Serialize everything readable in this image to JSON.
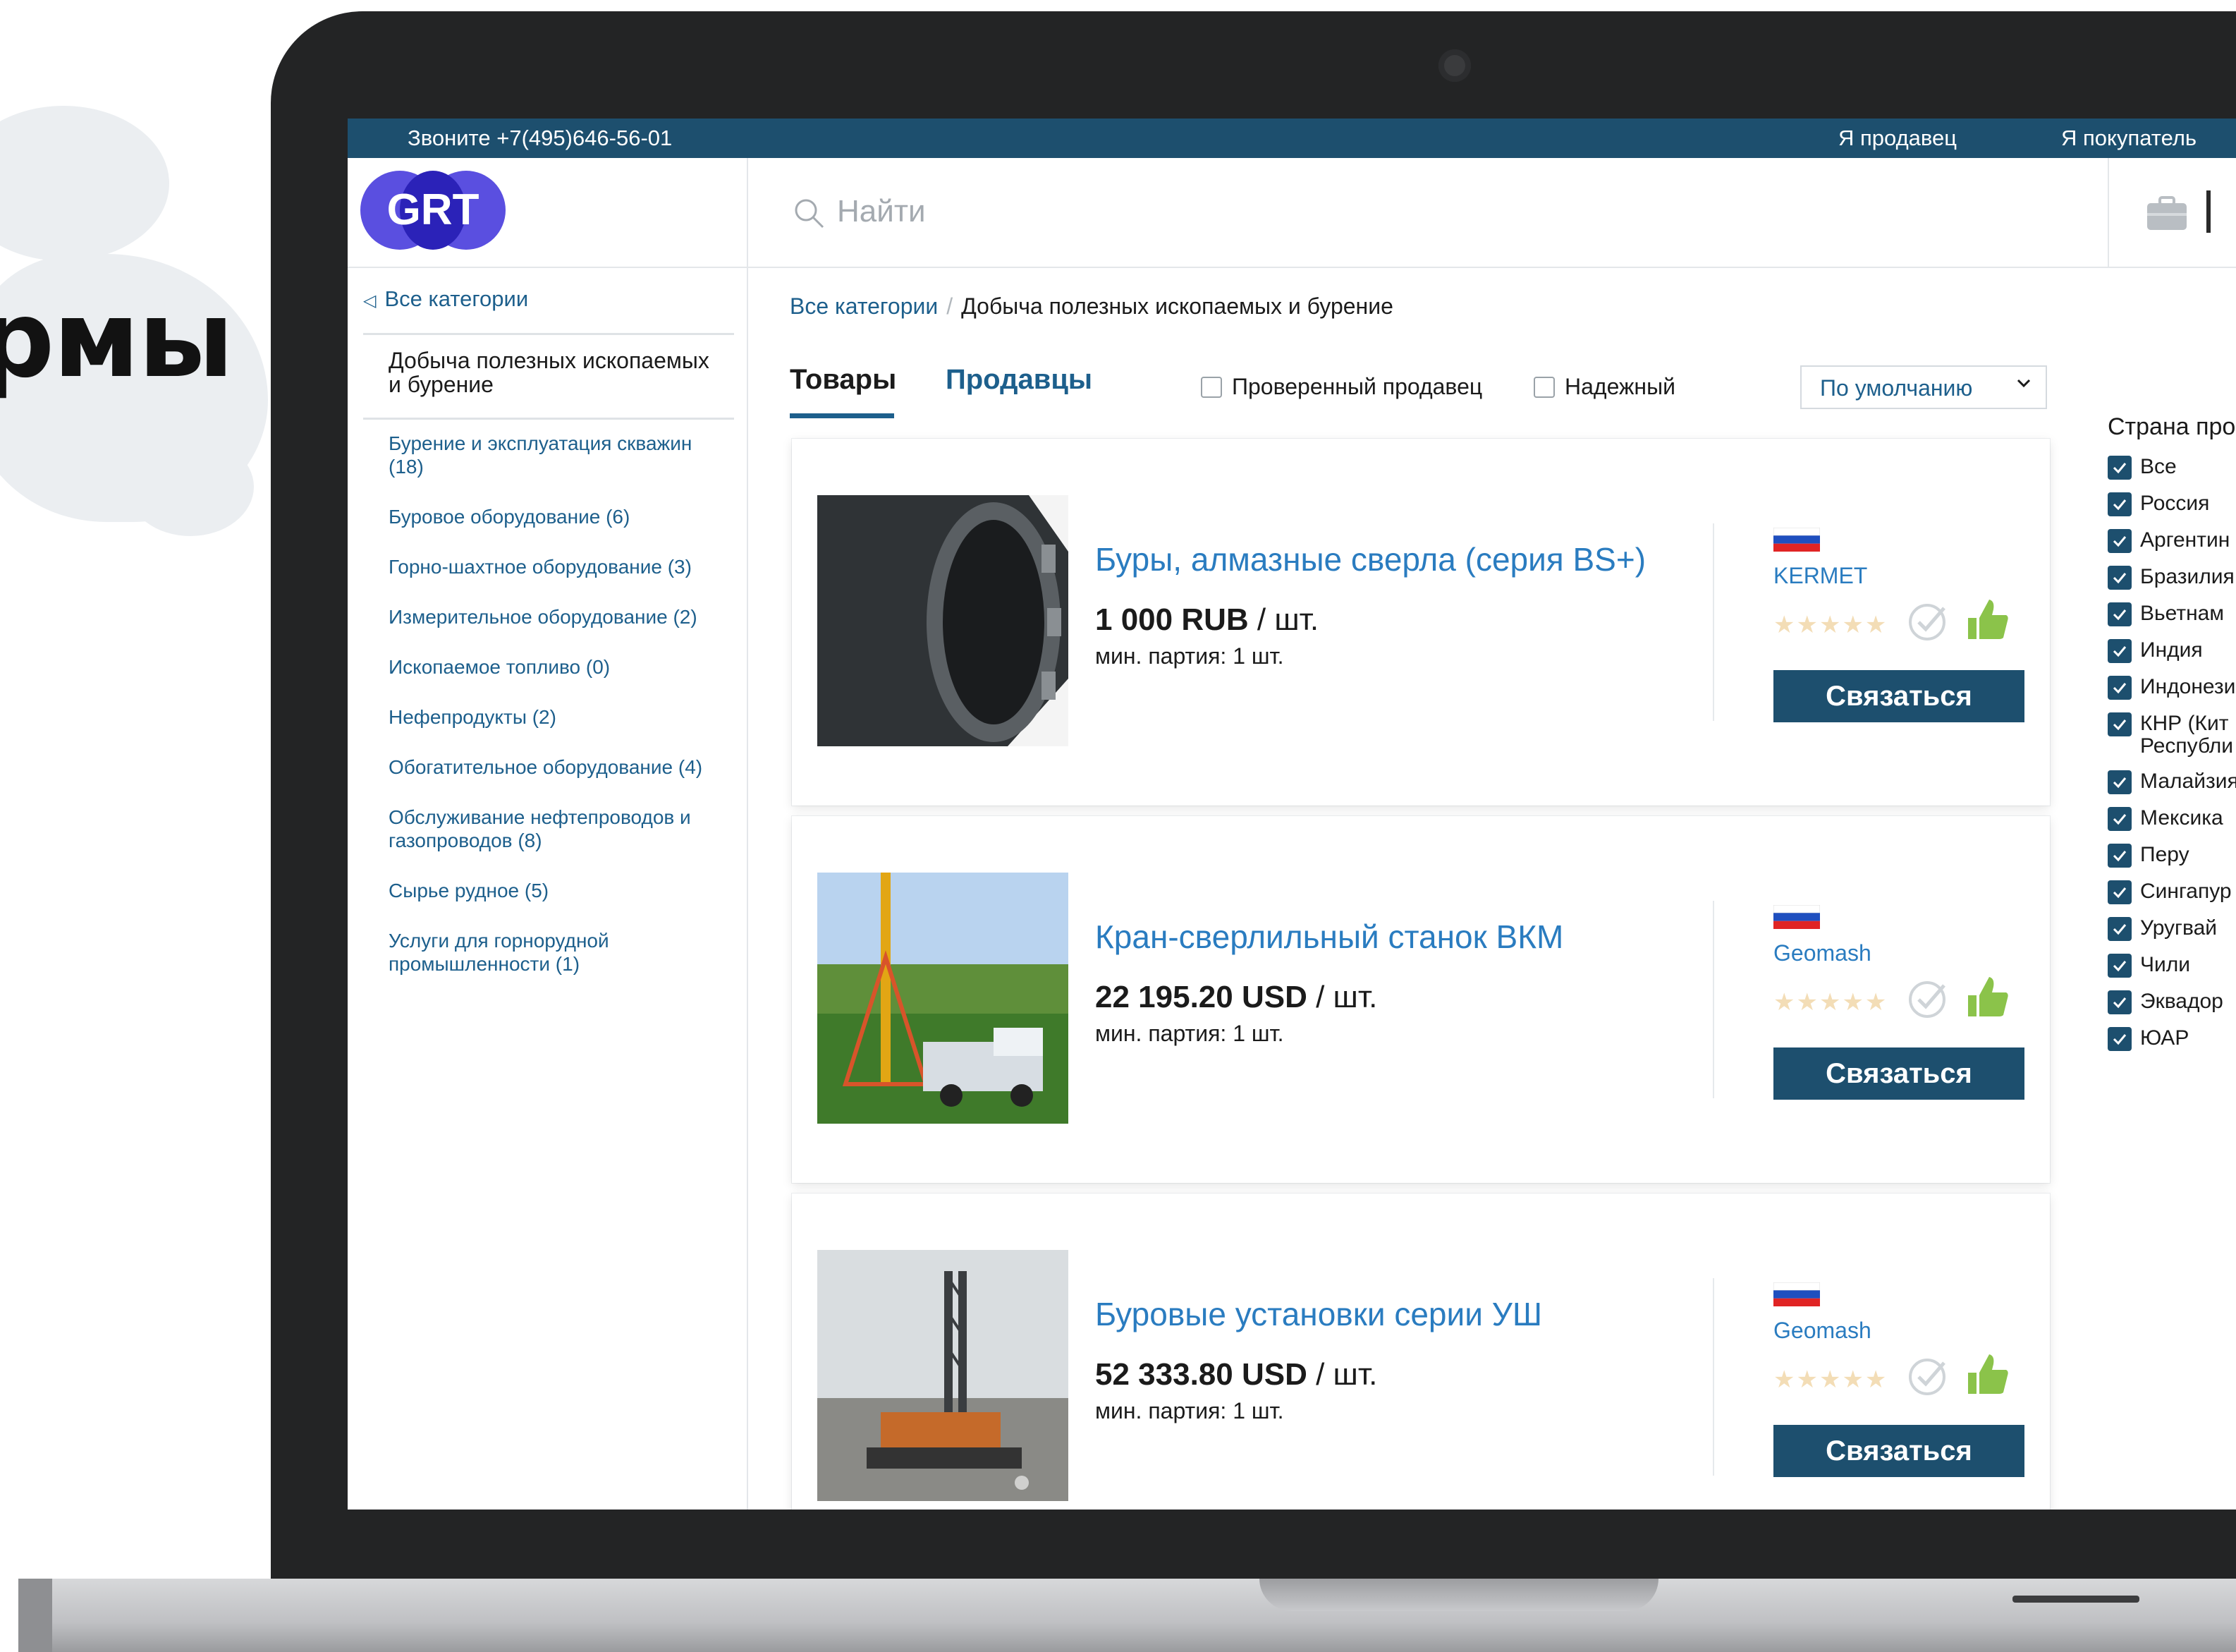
{
  "slide": {
    "title_fragment": "рмы"
  },
  "topbar": {
    "phone": "Звоните +7(495)646-56-01",
    "seller": "Я продавец",
    "buyer": "Я покупатель"
  },
  "header": {
    "logo_text": "GRT",
    "search_placeholder": "Найти"
  },
  "sidebar": {
    "all_categories": "Все категории",
    "current_category": "Добыча полезных ископаемых и бурение",
    "items": [
      {
        "label": "Бурение и эксплуатация скважин (18)"
      },
      {
        "label": "Буровое оборудование (6)"
      },
      {
        "label": "Горно-шахтное оборудование (3)"
      },
      {
        "label": "Измерительное оборудование (2)"
      },
      {
        "label": "Ископаемое топливо (0)"
      },
      {
        "label": "Нефепродукты (2)"
      },
      {
        "label": "Обогатительное оборудование (4)"
      },
      {
        "label": "Обслуживание нефтепроводов и газопроводов (8)"
      },
      {
        "label": "Сырье рудное (5)"
      },
      {
        "label": "Услуги для горнорудной промышленности (1)"
      }
    ]
  },
  "breadcrumb": {
    "root": "Все категории",
    "separator": "/",
    "current": "Добыча полезных ископаемых и бурение"
  },
  "tabs": {
    "goods": "Товары",
    "sellers": "Продавцы"
  },
  "filters": {
    "verified": "Проверенный продавец",
    "reliable": "Надежный",
    "sort_value": "По умолчанию"
  },
  "products": [
    {
      "title": "Буры, алмазные сверла (серия BS+)",
      "price": "1 000 RUB",
      "unit": "/ шт.",
      "min_batch": "мин. партия: 1 шт.",
      "seller": "KERMET",
      "stars": "★★★★★",
      "contact": "Связаться"
    },
    {
      "title": "Кран-сверлильный станок ВКМ",
      "price": "22 195.20 USD",
      "unit": "/ шт.",
      "min_batch": "мин. партия: 1 шт.",
      "seller": "Geomash",
      "stars": "★★★★★",
      "contact": "Связаться"
    },
    {
      "title": "Буровые установки серии УШ",
      "price": "52 333.80 USD",
      "unit": "/ шт.",
      "min_batch": "мин. партия: 1 шт.",
      "seller": "Geomash",
      "stars": "★★★★★",
      "contact": "Связаться"
    }
  ],
  "countries": {
    "title": "Страна про",
    "items": [
      {
        "label": "Все"
      },
      {
        "label": "Россия"
      },
      {
        "label": "Аргентин"
      },
      {
        "label": "Бразилия"
      },
      {
        "label": "Вьетнам"
      },
      {
        "label": "Индия"
      },
      {
        "label": "Индонези"
      },
      {
        "label": "КНР (Кит Республи"
      },
      {
        "label": "Малайзия"
      },
      {
        "label": "Мексика"
      },
      {
        "label": "Перу"
      },
      {
        "label": "Сингапур"
      },
      {
        "label": "Уругвай"
      },
      {
        "label": "Чили"
      },
      {
        "label": "Эквадор"
      },
      {
        "label": "ЮАР"
      }
    ]
  },
  "colors": {
    "topbar": "#1d4f6e",
    "link": "#1d5f8c",
    "title_link": "#2a7cc0",
    "button": "#1d4f6e",
    "logo": "#5a4fe0"
  }
}
